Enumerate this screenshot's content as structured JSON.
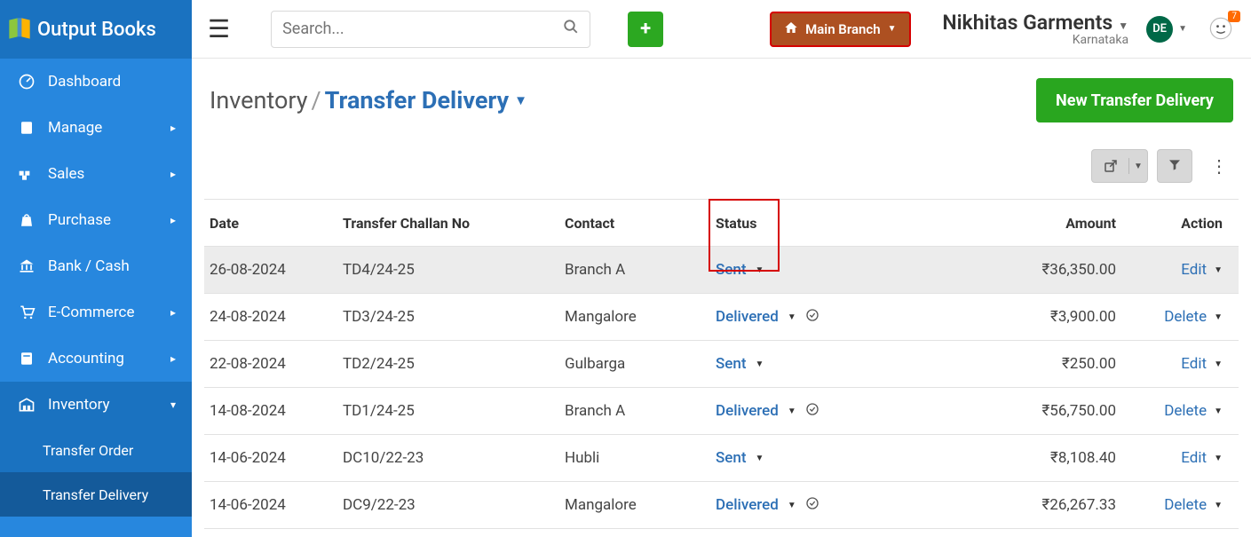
{
  "app": {
    "name": "Output Books"
  },
  "search": {
    "placeholder": "Search..."
  },
  "branch": {
    "label": "Main Branch"
  },
  "org": {
    "name": "Nikhitas Garments",
    "location": "Karnataka",
    "avatar": "DE",
    "notif_count": "7"
  },
  "sidebar": {
    "items": [
      {
        "label": "Dashboard",
        "icon": "dashboard"
      },
      {
        "label": "Manage",
        "icon": "manage",
        "expandable": true
      },
      {
        "label": "Sales",
        "icon": "sales",
        "expandable": true
      },
      {
        "label": "Purchase",
        "icon": "purchase",
        "expandable": true
      },
      {
        "label": "Bank / Cash",
        "icon": "bank"
      },
      {
        "label": "E-Commerce",
        "icon": "ecommerce",
        "expandable": true
      },
      {
        "label": "Accounting",
        "icon": "accounting",
        "expandable": true
      },
      {
        "label": "Inventory",
        "icon": "inventory",
        "expandable": true,
        "active": true
      }
    ],
    "sub": [
      {
        "label": "Transfer Order"
      },
      {
        "label": "Transfer Delivery",
        "active": true
      }
    ]
  },
  "breadcrumb": {
    "root": "Inventory",
    "current": "Transfer Delivery"
  },
  "new_button": "New Transfer Delivery",
  "table": {
    "headers": {
      "date": "Date",
      "challan": "Transfer Challan No",
      "contact": "Contact",
      "status": "Status",
      "amount": "Amount",
      "action": "Action"
    },
    "rows": [
      {
        "date": "26-08-2024",
        "challan": "TD4/24-25",
        "contact": "Branch A",
        "status": "Sent",
        "amount": "₹36,350.00",
        "action": "Edit",
        "checked": false,
        "hl": true
      },
      {
        "date": "24-08-2024",
        "challan": "TD3/24-25",
        "contact": "Mangalore",
        "status": "Delivered",
        "amount": "₹3,900.00",
        "action": "Delete",
        "checked": true
      },
      {
        "date": "22-08-2024",
        "challan": "TD2/24-25",
        "contact": "Gulbarga",
        "status": "Sent",
        "amount": "₹250.00",
        "action": "Edit",
        "checked": false
      },
      {
        "date": "14-08-2024",
        "challan": "TD1/24-25",
        "contact": "Branch A",
        "status": "Delivered",
        "amount": "₹56,750.00",
        "action": "Delete",
        "checked": true
      },
      {
        "date": "14-06-2024",
        "challan": "DC10/22-23",
        "contact": "Hubli",
        "status": "Sent",
        "amount": "₹8,108.40",
        "action": "Edit",
        "checked": false
      },
      {
        "date": "14-06-2024",
        "challan": "DC9/22-23",
        "contact": "Mangalore",
        "status": "Delivered",
        "amount": "₹26,267.33",
        "action": "Delete",
        "checked": true
      }
    ]
  }
}
